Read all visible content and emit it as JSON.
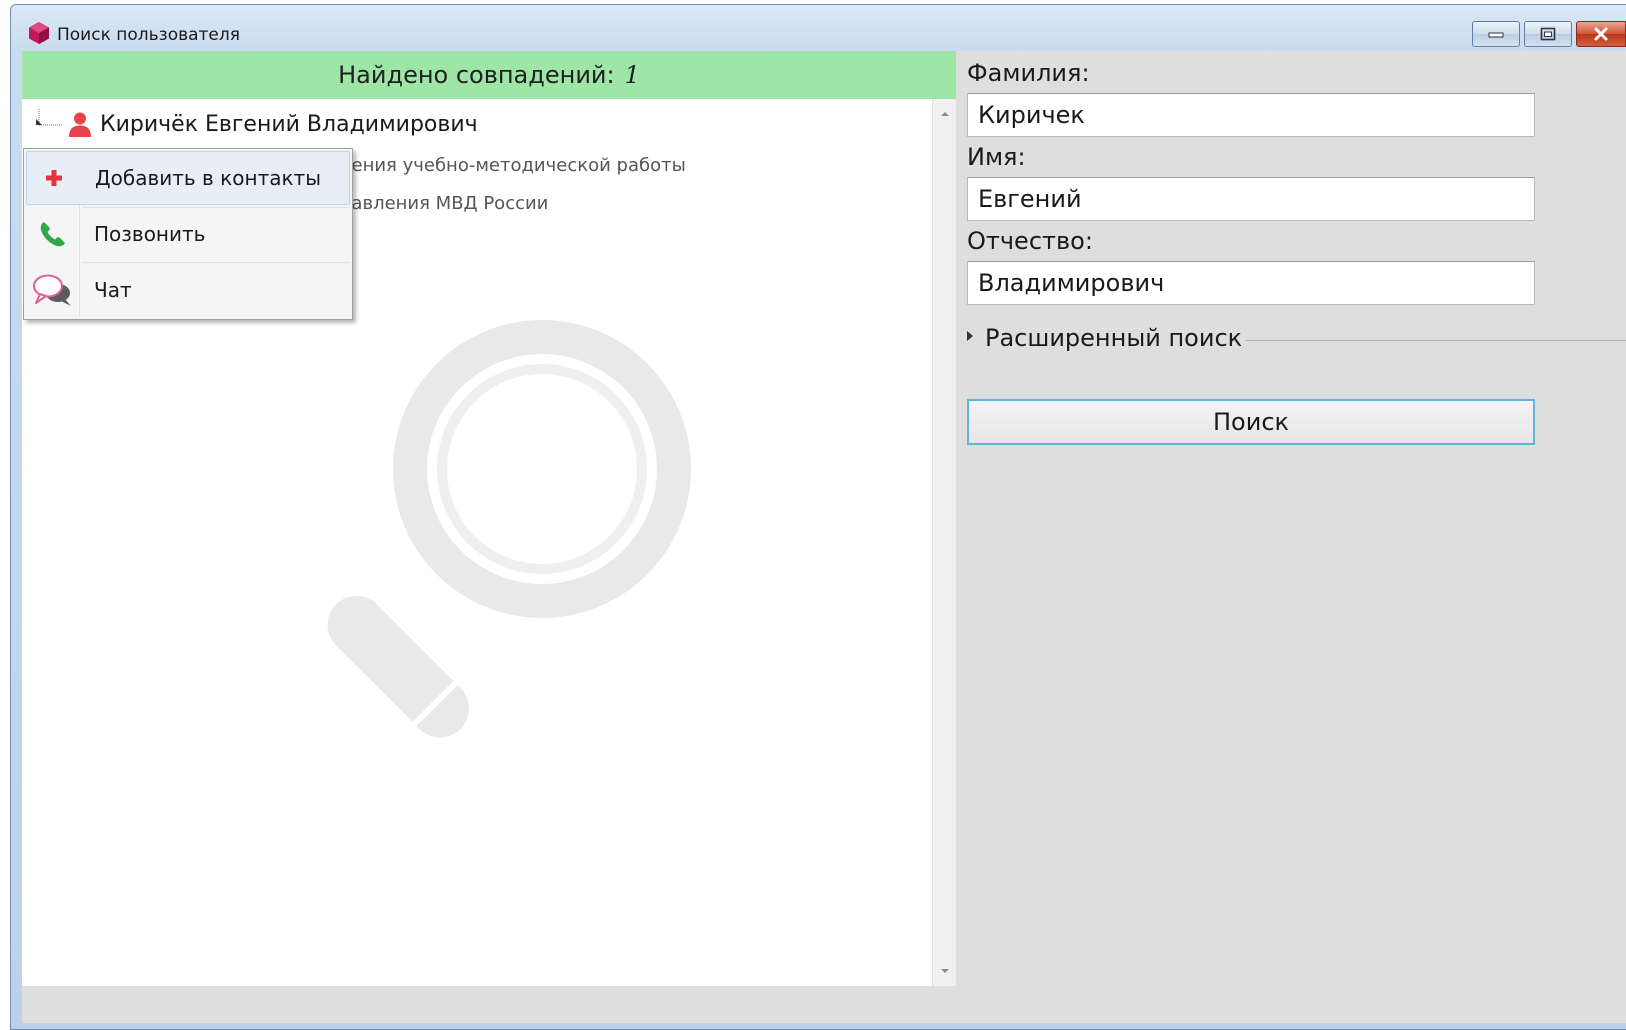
{
  "window": {
    "title": "Поиск пользователя",
    "controls": {
      "minimize": "minimize-icon",
      "maximize": "maximize-icon",
      "close": "close-icon"
    }
  },
  "results": {
    "found_label": "Найдено совпадений:",
    "found_count": "1",
    "user": {
      "name": "Киричёк Евгений Владимирович",
      "detail1": "ления учебно-методической работы",
      "detail2": "равления МВД России"
    }
  },
  "context_menu": {
    "items": [
      {
        "label": "Добавить в контакты",
        "icon": "plus-icon"
      },
      {
        "label": "Позвонить",
        "icon": "phone-icon"
      },
      {
        "label": "Чат",
        "icon": "chat-icon"
      }
    ]
  },
  "search": {
    "last_name_label": "Фамилия:",
    "last_name_value": "Киричек",
    "first_name_label": "Имя:",
    "first_name_value": "Евгений",
    "patronymic_label": "Отчество:",
    "patronymic_value": "Владимирович",
    "advanced_label": "Расширенный поиск",
    "button_label": "Поиск"
  },
  "colors": {
    "found_bar": "#9ee6a6",
    "search_button_border": "#5fb3dc",
    "close_button": "#c9472c",
    "accent_red": "#e8424a"
  }
}
